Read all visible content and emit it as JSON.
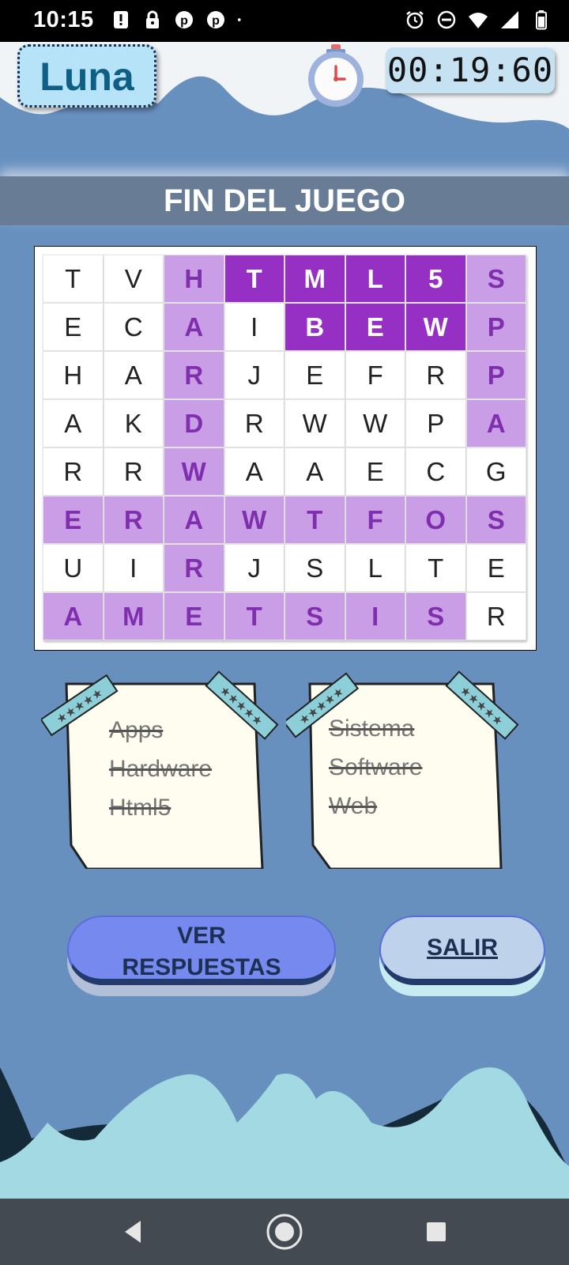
{
  "status_bar": {
    "time": "10:15",
    "left_icons": [
      "alert-icon",
      "lock-icon",
      "pinterest-icon",
      "pinterest-icon",
      "dot-icon"
    ],
    "right_icons": [
      "alarm-icon",
      "do-not-disturb-icon",
      "wifi-icon",
      "signal-icon",
      "battery-icon"
    ]
  },
  "header": {
    "logo_text": "Luna",
    "timer": "00:19:60",
    "timer_icon": "stopwatch-icon"
  },
  "title": "FIN DEL JUEGO",
  "grid": {
    "rows": [
      [
        "T",
        "V",
        "H",
        "T",
        "M",
        "L",
        "5",
        "S"
      ],
      [
        "E",
        "C",
        "A",
        "I",
        "B",
        "E",
        "W",
        "P"
      ],
      [
        "H",
        "A",
        "R",
        "J",
        "E",
        "F",
        "R",
        "P"
      ],
      [
        "A",
        "K",
        "D",
        "R",
        "W",
        "W",
        "P",
        "A"
      ],
      [
        "R",
        "R",
        "W",
        "A",
        "A",
        "E",
        "C",
        "G"
      ],
      [
        "E",
        "R",
        "A",
        "W",
        "T",
        "F",
        "O",
        "S"
      ],
      [
        "U",
        "I",
        "R",
        "J",
        "S",
        "L",
        "T",
        "E"
      ],
      [
        "A",
        "M",
        "E",
        "T",
        "S",
        "I",
        "S",
        "R"
      ]
    ],
    "states": [
      [
        "n",
        "n",
        "f",
        "s",
        "s",
        "s",
        "s",
        "f"
      ],
      [
        "n",
        "n",
        "f",
        "n",
        "s",
        "s",
        "s",
        "f"
      ],
      [
        "n",
        "n",
        "f",
        "n",
        "n",
        "n",
        "n",
        "f"
      ],
      [
        "n",
        "n",
        "f",
        "n",
        "n",
        "n",
        "n",
        "f"
      ],
      [
        "n",
        "n",
        "f",
        "n",
        "n",
        "n",
        "n",
        "n"
      ],
      [
        "f",
        "f",
        "f",
        "f",
        "f",
        "f",
        "f",
        "f"
      ],
      [
        "n",
        "n",
        "f",
        "n",
        "n",
        "n",
        "n",
        "n"
      ],
      [
        "f",
        "f",
        "f",
        "f",
        "f",
        "f",
        "f",
        "n"
      ]
    ]
  },
  "notes": {
    "left": [
      "Apps",
      "Hardware",
      "Html5"
    ],
    "right": [
      "Sistema",
      "Software",
      "Web"
    ]
  },
  "buttons": {
    "ver_respuestas_line1": "VER",
    "ver_respuestas_line2": "RESPUESTAS",
    "salir": "SALIR"
  },
  "colors": {
    "background": "#6890bf",
    "title_band": "#687c96",
    "found_cell": "#c99ee6",
    "selected_cell": "#9630c4",
    "found_text": "#7f2fae"
  },
  "nav": {
    "back_icon": "back-triangle-icon",
    "home_icon": "home-circle-icon",
    "recents_icon": "recents-square-icon"
  }
}
